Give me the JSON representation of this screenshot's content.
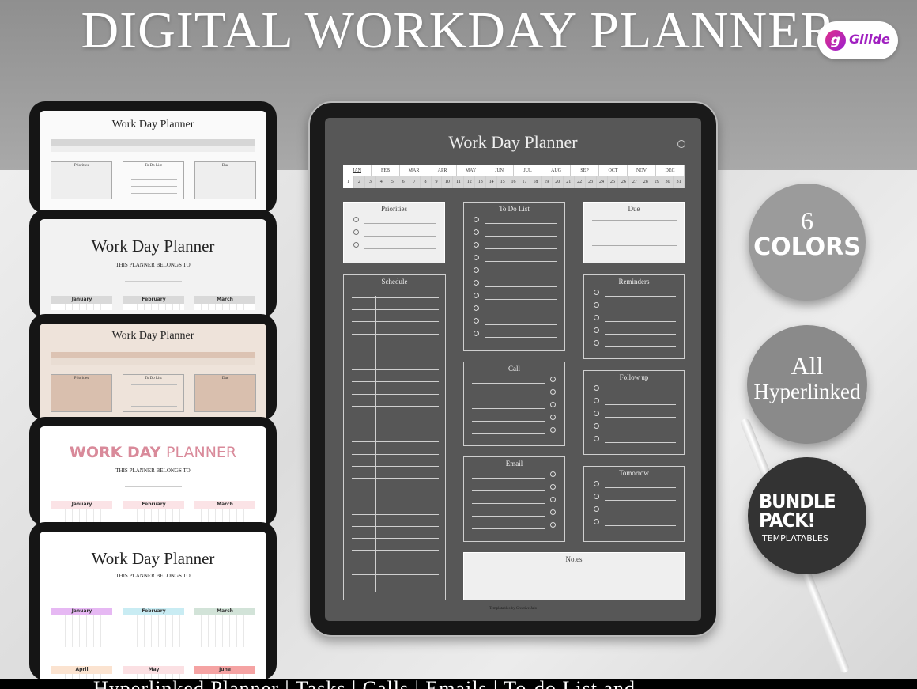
{
  "headline": "DIGITAL WORKDAY PLANNER",
  "brand": {
    "logo_letter": "g",
    "name": "Gillde"
  },
  "planner": {
    "title": "Work Day Planner",
    "settings_icon": "gear-icon",
    "months": [
      "JAN",
      "FEB",
      "MAR",
      "APR",
      "MAY",
      "JUN",
      "JUL",
      "AUG",
      "SEP",
      "OCT",
      "NOV",
      "DEC"
    ],
    "days": [
      "1",
      "2",
      "3",
      "4",
      "5",
      "6",
      "7",
      "8",
      "9",
      "10",
      "11",
      "12",
      "13",
      "14",
      "15",
      "16",
      "17",
      "18",
      "19",
      "20",
      "21",
      "22",
      "23",
      "24",
      "25",
      "26",
      "27",
      "28",
      "29",
      "30",
      "31"
    ],
    "sections": {
      "priorities": "Priorities",
      "todo": "To Do List",
      "due": "Due",
      "schedule": "Schedule",
      "reminders": "Reminders",
      "call": "Call",
      "followup": "Follow up",
      "email": "Email",
      "tomorrow": "Tomorrow",
      "notes": "Notes"
    },
    "footer": "Templatables by Creative Jalo"
  },
  "previews": {
    "title": "Work Day Planner",
    "title_caps_a": "WORK DAY",
    "title_caps_b": "PLANNER",
    "belongs": "THIS PLANNER BELONGS TO",
    "sections": [
      "Priorities",
      "To Do List",
      "Due"
    ],
    "months": [
      "January",
      "February",
      "March",
      "April",
      "May",
      "June"
    ]
  },
  "badges": {
    "colors_num": "6",
    "colors": "COLORS",
    "hyper_a": "All",
    "hyper_b": "Hyperlinked",
    "bundle": "BUNDLE PACK!",
    "bundle_sub": "TEMPLATABLES"
  },
  "bottom_banner": "Hyperlinked Planner | Tasks | Calls | Emails | To-do List and",
  "colors": {
    "dark_screen": "#575757",
    "pink_accent": "#d98a9a",
    "tan": "#e3d2c5"
  }
}
